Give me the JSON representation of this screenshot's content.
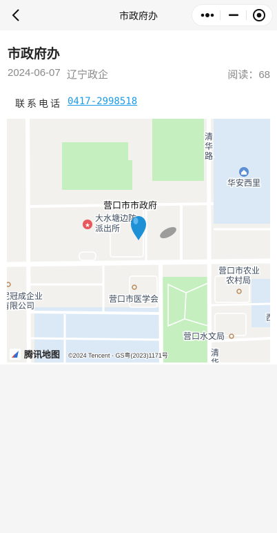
{
  "navbar": {
    "title": "市政府办",
    "back_icon": "chevron-left-icon",
    "more_icon": "more-dots-icon",
    "minimize_icon": "minimize-icon",
    "close_icon": "target-close-icon"
  },
  "article": {
    "title": "市政府办",
    "date": "2024-06-07",
    "source": "辽宁政企",
    "read_count": "阅读：68",
    "phone_label": "联系电话",
    "phone_number": "0417-2998518"
  },
  "map": {
    "pin_label": "营口市市政府",
    "labels": {
      "police_line1": "大水塘边防",
      "police_line2": "派出所",
      "road_line1": "清",
      "road_line2": "华",
      "road_line3": "路",
      "huaan": "华安西里",
      "agri_line1": "营口市农业",
      "agri_line2": "农村局",
      "medical": "营口市医学会",
      "company_line1": "泥冠成企业",
      "company_line2": "有限公司",
      "water": "营口水文局",
      "edge_right": "西",
      "road2_line1": "清",
      "road2_line2": "华"
    },
    "logo_text": "腾讯地图",
    "copyright": "©2024 Tencent - GS粤(2023)1171号",
    "colors": {
      "land": "#f2f1ee",
      "green": "#c6efc0",
      "water": "#dbe9f6",
      "road": "#ffffff",
      "pin": "#1e90d6"
    }
  }
}
